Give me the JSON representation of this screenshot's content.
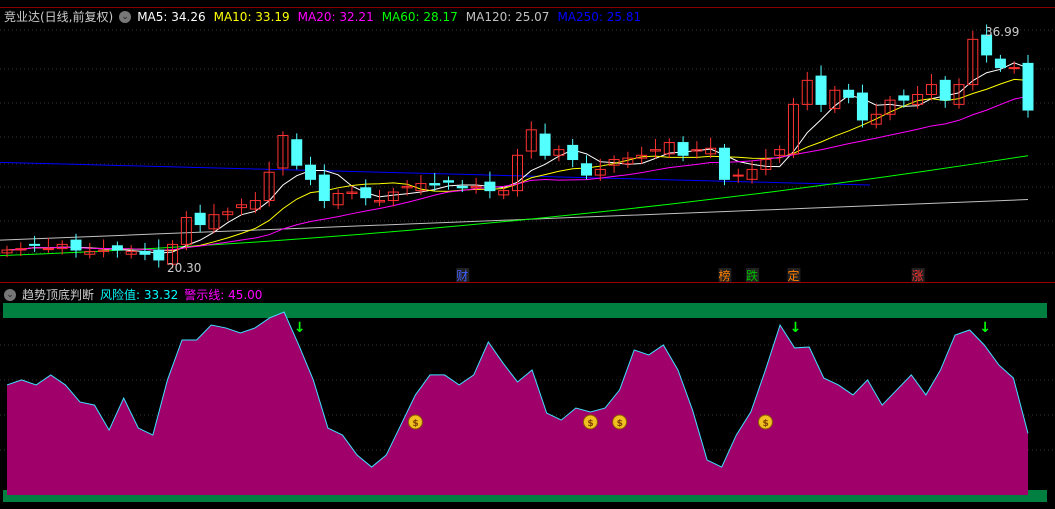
{
  "title": "竞业达(日线,前复权)",
  "ma_labels": [
    {
      "text": "MA5: 34.26",
      "color": "#ffffff"
    },
    {
      "text": "MA10: 33.19",
      "color": "#ffff00"
    },
    {
      "text": "MA20: 32.21",
      "color": "#ff00ff"
    },
    {
      "text": "MA60: 28.17",
      "color": "#00ff00"
    },
    {
      "text": "MA120: 25.07",
      "color": "#c0c0c0"
    },
    {
      "text": "MA250: 25.81",
      "color": "#0000ff"
    }
  ],
  "high_label": "36.99",
  "low_label": "20.30",
  "events": [
    {
      "text": "财",
      "color": "#4060ff",
      "idx": 33
    },
    {
      "text": "榜",
      "color": "#ff8000",
      "idx": 52
    },
    {
      "text": "跌",
      "color": "#00c000",
      "idx": 54
    },
    {
      "text": "定",
      "color": "#ff8000",
      "idx": 57
    },
    {
      "text": "涨",
      "color": "#ff3030",
      "idx": 66
    }
  ],
  "indicator": {
    "name": "趋势顶底判断",
    "risk_label": "风险值: 33.32",
    "warn_label": "警示线: 45.00"
  },
  "chart_data": {
    "type": "candlestick",
    "closes": [
      21.5,
      21.6,
      21.9,
      21.6,
      21.9,
      21.5,
      21.4,
      21.5,
      21.5,
      21.4,
      21.2,
      20.8,
      21.9,
      23.8,
      23.3,
      24.0,
      24.2,
      24.7,
      25.0,
      27.0,
      29.6,
      27.5,
      26.5,
      25.0,
      25.5,
      25.6,
      25.2,
      25.0,
      25.6,
      26.0,
      26.2,
      26.1,
      26.3,
      25.9,
      26.0,
      25.7,
      25.7,
      28.2,
      30.0,
      28.2,
      28.6,
      27.9,
      26.8,
      27.2,
      27.9,
      28.0,
      28.2,
      28.6,
      29.1,
      28.2,
      28.6,
      28.7,
      26.5,
      26.8,
      27.2,
      27.9,
      28.6,
      31.8,
      33.5,
      31.8,
      32.8,
      32.3,
      30.7,
      31.1,
      32.1,
      32.1,
      32.5,
      33.2,
      32.1,
      33.2,
      36.4,
      35.3,
      34.4,
      34.4,
      31.4
    ],
    "ma60": [
      21.1,
      28.17
    ],
    "ma120": [
      22.2,
      25.07
    ],
    "ma250": [
      27.7,
      26.1
    ],
    "price_range": [
      20.3,
      36.99
    ],
    "risk": [
      59.5,
      62.2,
      59.5,
      64.9,
      59.5,
      50.3,
      48.6,
      35.1,
      52.4,
      36.2,
      32.4,
      62.2,
      83.8,
      83.8,
      91.9,
      90.3,
      87.6,
      90.3,
      95.7,
      98.9,
      81.1,
      62.2,
      36.2,
      32.4,
      21.6,
      15.1,
      21.6,
      37.8,
      54.1,
      64.9,
      64.9,
      59.5,
      64.9,
      82.7,
      71.4,
      61.1,
      67.6,
      44.3,
      40.5,
      47.0,
      44.9,
      47.0,
      56.8,
      78.4,
      75.7,
      81.1,
      67.6,
      45.9,
      18.9,
      15.1,
      32.4,
      44.9,
      67.6,
      91.9,
      79.5,
      80.0,
      63.2,
      59.5,
      54.1,
      62.2,
      48.6,
      56.8,
      64.9,
      54.1,
      67.6,
      86.5,
      89.2,
      81.1,
      70.3,
      63.2,
      33.3
    ],
    "top_arrows": [
      20,
      54,
      67
    ],
    "bottom_signals": [
      28,
      40,
      42,
      52
    ]
  }
}
